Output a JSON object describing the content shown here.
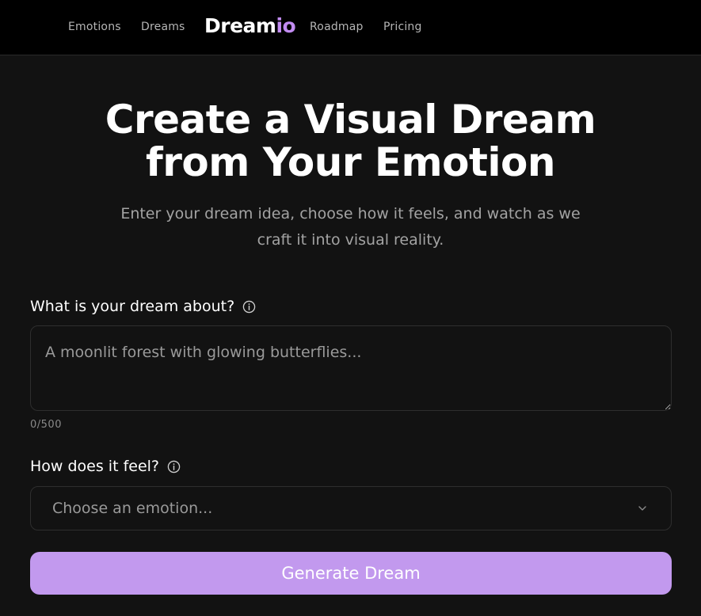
{
  "nav": {
    "links": [
      {
        "label": "Emotions"
      },
      {
        "label": "Dreams"
      },
      {
        "label": "Roadmap"
      },
      {
        "label": "Pricing"
      }
    ],
    "logo": {
      "main": "Dream",
      "accent": "io"
    }
  },
  "hero": {
    "title_line1": "Create a Visual Dream",
    "title_line2": "from Your Emotion",
    "subtitle": "Enter your dream idea, choose how it feels, and watch as we craft it into visual reality."
  },
  "form": {
    "dream": {
      "label": "What is your dream about?",
      "placeholder": "A moonlit forest with glowing butterflies...",
      "value": "",
      "char_count": "0/500"
    },
    "emotion": {
      "label": "How does it feel?",
      "placeholder": "Choose an emotion..."
    },
    "submit_label": "Generate Dream"
  },
  "colors": {
    "background": "#121212",
    "navbar": "#000000",
    "accent": "#c28cf2",
    "button": "#c299ee"
  }
}
